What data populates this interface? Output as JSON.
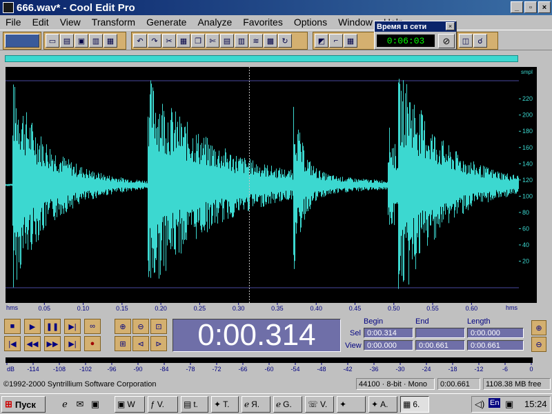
{
  "window": {
    "title": "666.wav* - Cool Edit Pro",
    "min": "_",
    "max": "▫",
    "close": "×"
  },
  "menu": [
    "File",
    "Edit",
    "View",
    "Transform",
    "Generate",
    "Analyze",
    "Favorites",
    "Options",
    "Window",
    "Help"
  ],
  "timer_window": {
    "title": "Время в сети",
    "value": "0:06:03",
    "close": "×",
    "stop_icon": "⊘"
  },
  "toolbar_icons": [
    "multitrack-icon",
    "new-icon",
    "open-icon",
    "save-icon",
    "save-as-icon",
    "close-file-icon",
    "undo-icon",
    "redo-icon",
    "cut-tool-icon",
    "mix-icon",
    "copy-icon",
    "scissors-icon",
    "paste-icon",
    "paste-mix-icon",
    "waveform-icon",
    "spectral-icon",
    "loop-icon",
    "envelope-icon",
    "marker-icon",
    "favorite-icon",
    "hand-icon"
  ],
  "waveform": {
    "axis_unit_y": "smpl",
    "y_ticks": [
      "220",
      "200",
      "180",
      "160",
      "140",
      "120",
      "100",
      "80",
      "60",
      "40",
      "20"
    ],
    "x_unit": "hms",
    "x_ticks": [
      "0.05",
      "0.10",
      "0.15",
      "0.20",
      "0.25",
      "0.30",
      "0.35",
      "0.40",
      "0.45",
      "0.50",
      "0.55",
      "0.60"
    ],
    "x_unit_right": "hms",
    "cursor_time": 0.314,
    "duration": 0.661,
    "waveform_color": "#3cd8d0",
    "hits": [
      {
        "t": 0.008,
        "peak": 1.0,
        "decay": 0.05
      },
      {
        "t": 0.183,
        "peak": 1.0,
        "decay": 0.09
      },
      {
        "t": 0.37,
        "peak": 0.75,
        "decay": 0.012
      },
      {
        "t": 0.492,
        "peak": 0.55,
        "decay": 0.02
      },
      {
        "t": 0.505,
        "peak": 1.0,
        "decay": 0.06
      }
    ]
  },
  "transport": {
    "row1": [
      "■",
      "▶",
      "❚❚",
      "▶|",
      "∞"
    ],
    "row2": [
      "|◀",
      "◀◀",
      "▶▶",
      "▶|",
      "●"
    ]
  },
  "time_display": "0:00.314",
  "selection": {
    "headers": [
      "Begin",
      "End",
      "Length"
    ],
    "sel_label": "Sel",
    "view_label": "View",
    "sel": [
      "0:00.314",
      "",
      "0:00.000"
    ],
    "view": [
      "0:00.000",
      "0:00.661",
      "0:00.661"
    ]
  },
  "level_meter": {
    "labels": [
      "dB",
      "-114",
      "-108",
      "-102",
      "-96",
      "-90",
      "-84",
      "-78",
      "-72",
      "-66",
      "-60",
      "-54",
      "-48",
      "-42",
      "-36",
      "-30",
      "-24",
      "-18",
      "-12",
      "-6",
      "0"
    ]
  },
  "status": {
    "copyright": "©1992-2000 Syntrillium Software Corporation",
    "format": "44100 · 8-bit · Mono",
    "length": "0:00.661",
    "free": "1108.38 MB free"
  },
  "taskbar": {
    "start_label": "Пуск",
    "tasks": [
      {
        "label": "W",
        "icon": "disk"
      },
      {
        "label": "V.",
        "icon": "f"
      },
      {
        "label": "t.",
        "icon": "doc"
      },
      {
        "label": "T.",
        "icon": "star"
      },
      {
        "label": "Я.",
        "icon": "ie"
      },
      {
        "label": "G.",
        "icon": "ie"
      },
      {
        "label": "V.",
        "icon": "phone"
      },
      {
        "label": "",
        "icon": "star"
      },
      {
        "label": "A.",
        "icon": "star"
      },
      {
        "label": "6.",
        "icon": "cep"
      }
    ],
    "lang": "En",
    "clock": "15:24"
  }
}
